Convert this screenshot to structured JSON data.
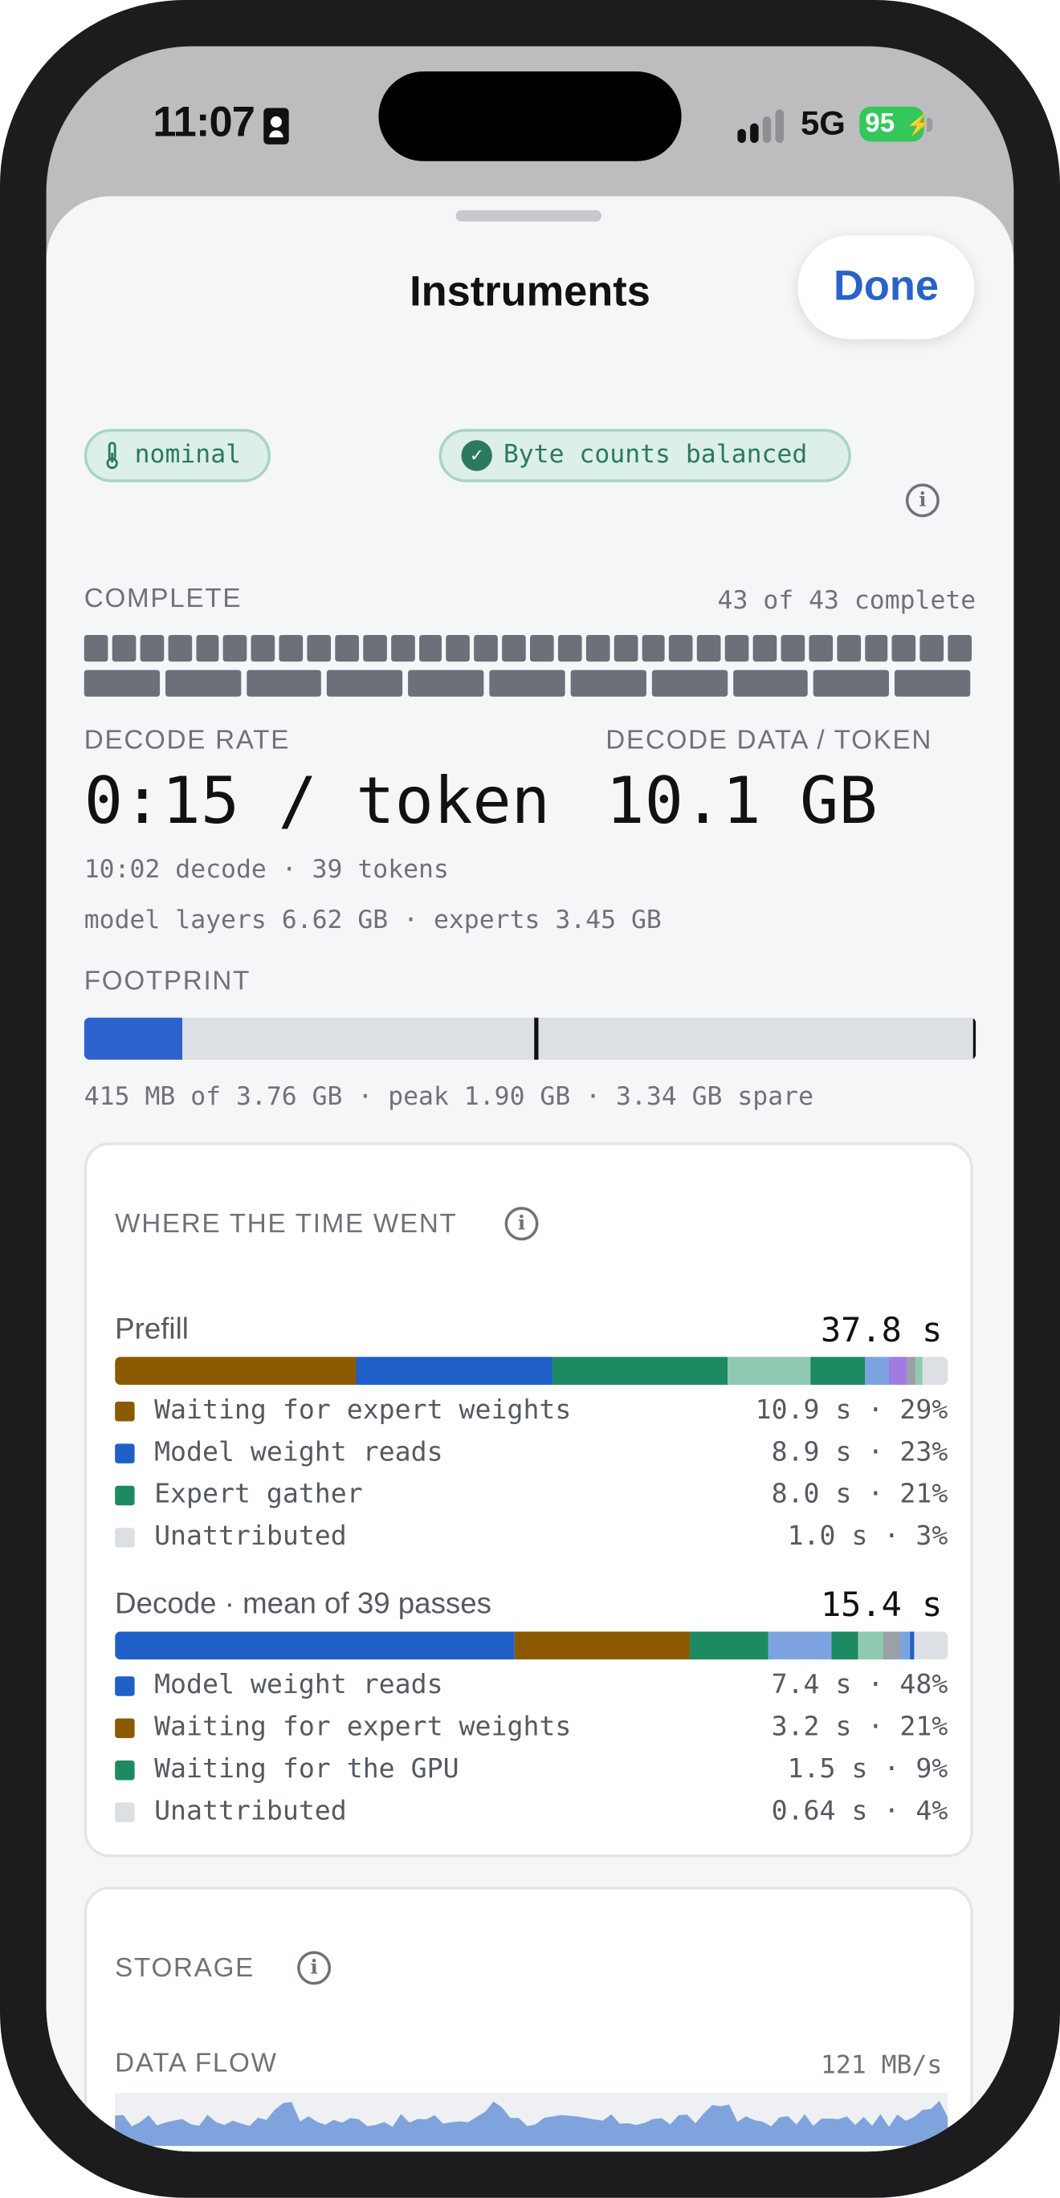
{
  "status_bar": {
    "time": "11:07",
    "network": "5G",
    "battery": "95"
  },
  "header": {
    "title": "Instruments",
    "done_label": "Done"
  },
  "badges": {
    "thermal": "nominal",
    "bytes": "Byte counts balanced"
  },
  "progress": {
    "label": "COMPLETE",
    "summary": "43 of 43 complete",
    "completed": 43,
    "total": 43
  },
  "decode": {
    "rate_label": "DECODE RATE",
    "data_label": "DECODE DATA / TOKEN",
    "rate_value": "0:15 / token",
    "data_value": "10.1 GB",
    "line1": "10:02 decode · 39 tokens",
    "line2": "model layers 6.62 GB · experts 3.45 GB"
  },
  "footprint": {
    "label": "FOOTPRINT",
    "summary": "415 MB of 3.76 GB · peak 1.90 GB · 3.34 GB spare",
    "used_fraction": 0.11,
    "peak_fraction": 0.505
  },
  "time_card": {
    "title": "WHERE THE TIME WENT",
    "prefill": {
      "label": "Prefill",
      "total": "37.8 s",
      "segments": [
        {
          "color": "#8b5a00",
          "fraction": 0.29
        },
        {
          "color": "#1f5fc8",
          "fraction": 0.235
        },
        {
          "color": "#1e8a62",
          "fraction": 0.21
        },
        {
          "color": "#8fc9b1",
          "fraction": 0.1
        },
        {
          "color": "#1e8a62",
          "fraction": 0.065
        },
        {
          "color": "#7ca3e0",
          "fraction": 0.03
        },
        {
          "color": "#a27be0",
          "fraction": 0.022
        },
        {
          "color": "#9aa0a6",
          "fraction": 0.01
        },
        {
          "color": "#8fc9b1",
          "fraction": 0.008
        },
        {
          "color": "#dcdfe4",
          "fraction": 0.03
        }
      ],
      "legend": [
        {
          "color": "#8b5a00",
          "label": "Waiting for expert weights",
          "value": "10.9 s · 29%"
        },
        {
          "color": "#1f5fc8",
          "label": "Model weight reads",
          "value": "8.9 s · 23%"
        },
        {
          "color": "#1e8a62",
          "label": "Expert gather",
          "value": "8.0 s · 21%"
        },
        {
          "color": "#dcdfe4",
          "label": "Unattributed",
          "value": "1.0 s · 3%"
        }
      ]
    },
    "decode": {
      "label": "Decode · mean of 39 passes",
      "total": "15.4 s",
      "segments": [
        {
          "color": "#1f5fc8",
          "fraction": 0.48
        },
        {
          "color": "#8b5a00",
          "fraction": 0.21
        },
        {
          "color": "#1e8a62",
          "fraction": 0.095
        },
        {
          "color": "#7ca3e0",
          "fraction": 0.075
        },
        {
          "color": "#1e8a62",
          "fraction": 0.033
        },
        {
          "color": "#8fc9b1",
          "fraction": 0.03
        },
        {
          "color": "#9aa0a6",
          "fraction": 0.02
        },
        {
          "color": "#7ca3e0",
          "fraction": 0.012
        },
        {
          "color": "#1f5fc8",
          "fraction": 0.004
        },
        {
          "color": "#dcdfe4",
          "fraction": 0.041
        }
      ],
      "legend": [
        {
          "color": "#1f5fc8",
          "label": "Model weight reads",
          "value": "7.4 s · 48%"
        },
        {
          "color": "#8b5a00",
          "label": "Waiting for expert weights",
          "value": "3.2 s · 21%"
        },
        {
          "color": "#1e8a62",
          "label": "Waiting for the GPU",
          "value": "1.5 s · 9%"
        },
        {
          "color": "#dcdfe4",
          "label": "Unattributed",
          "value": "0.64 s · 4%"
        }
      ]
    }
  },
  "storage_card": {
    "title": "STORAGE",
    "flow_label": "DATA FLOW",
    "flow_value": "121 MB/s"
  }
}
